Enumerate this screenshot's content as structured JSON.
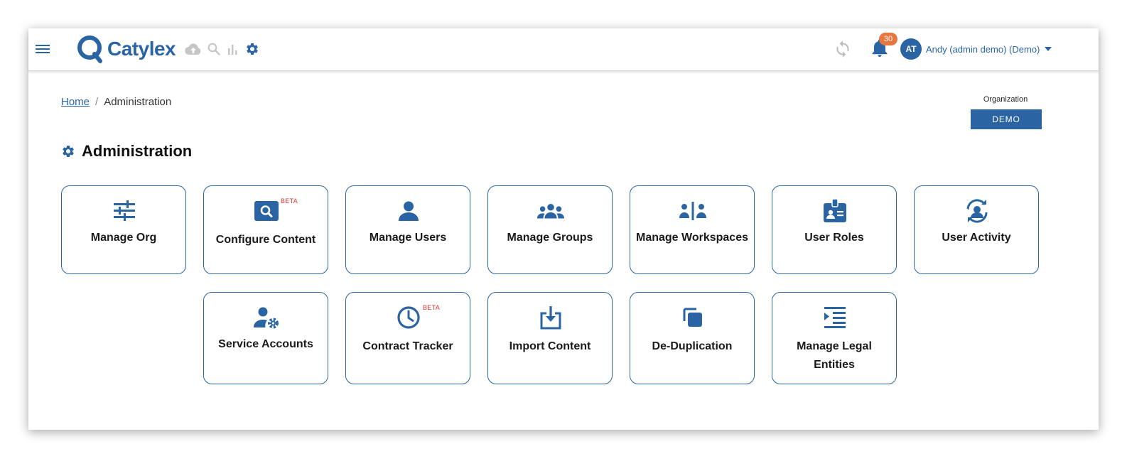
{
  "brand": {
    "name": "Catylex",
    "color": "#2a64a3"
  },
  "topbar": {
    "menu_icon": "hamburger-icon",
    "tools": [
      "cloud-upload-icon",
      "search-icon",
      "bar-chart-icon",
      "gear-icon"
    ],
    "sync_icon": "sync-icon",
    "notifications": {
      "icon": "bell-icon",
      "count": "30"
    },
    "user": {
      "initials": "AT",
      "name": "Andy (admin demo) (Demo)"
    }
  },
  "breadcrumb": {
    "home": "Home",
    "separator": "/",
    "current": "Administration"
  },
  "organization": {
    "label": "Organization",
    "value": "DEMO"
  },
  "page": {
    "title": "Administration",
    "title_icon": "gear-icon"
  },
  "beta_label": "BETA",
  "cards": [
    {
      "label": "Manage Org",
      "icon": "sliders-icon"
    },
    {
      "label": "Configure Content",
      "icon": "search-box-icon",
      "beta": true
    },
    {
      "label": "Manage Users",
      "icon": "user-icon"
    },
    {
      "label": "Manage Groups",
      "icon": "group-icon"
    },
    {
      "label": "Manage Workspaces",
      "icon": "workspaces-icon"
    },
    {
      "label": "User Roles",
      "icon": "id-badge-icon"
    },
    {
      "label": "User Activity",
      "icon": "user-activity-icon"
    },
    {
      "label": "Service Accounts",
      "icon": "user-gear-icon"
    },
    {
      "label": "Contract Tracker",
      "icon": "clock-icon",
      "beta": true
    },
    {
      "label": "Import Content",
      "icon": "import-icon"
    },
    {
      "label": "De-Duplication",
      "icon": "duplicate-icon"
    },
    {
      "label": "Manage Legal Entities",
      "icon": "indent-list-icon"
    }
  ]
}
